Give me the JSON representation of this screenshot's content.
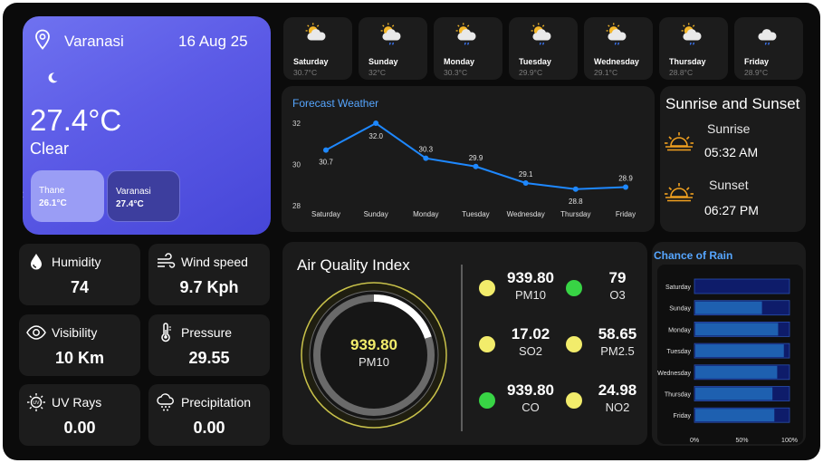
{
  "current": {
    "city": "Varanasi",
    "date": "16 Aug 25",
    "temperature": "27.4°C",
    "condition": "Clear",
    "locations": [
      {
        "name": "Thane",
        "temp": "26.1°C"
      },
      {
        "name": "Varanasi",
        "temp": "27.4°C"
      }
    ],
    "icons": {
      "location": "location-pin-icon",
      "moon": "moon-icon",
      "prev": "chevron-left-icon"
    }
  },
  "daily": [
    {
      "day": "Saturday",
      "temp": "30.7°C",
      "icon": "partly-cloudy-sun-icon"
    },
    {
      "day": "Sunday",
      "temp": "32°C",
      "icon": "sun-cloud-rain-icon"
    },
    {
      "day": "Monday",
      "temp": "30.3°C",
      "icon": "sun-cloud-rain-icon"
    },
    {
      "day": "Tuesday",
      "temp": "29.9°C",
      "icon": "sun-cloud-rain-icon"
    },
    {
      "day": "Wednesday",
      "temp": "29.1°C",
      "icon": "sun-cloud-rain-icon"
    },
    {
      "day": "Thursday",
      "temp": "28.8°C",
      "icon": "sun-cloud-rain-icon"
    },
    {
      "day": "Friday",
      "temp": "28.9°C",
      "icon": "cloud-rain-icon"
    }
  ],
  "forecast": {
    "title": "Forecast Weather",
    "chart_data": {
      "type": "line",
      "categories": [
        "Saturday",
        "Sunday",
        "Monday",
        "Tuesday",
        "Wednesday",
        "Thursday",
        "Friday"
      ],
      "values": [
        30.7,
        32.0,
        30.3,
        29.9,
        29.1,
        28.8,
        28.9
      ],
      "data_labels": [
        "30.7",
        "32.0",
        "30.3",
        "29.9",
        "29.1",
        "28.8",
        "28.9"
      ],
      "yticks": [
        "32",
        "30",
        "28"
      ],
      "ylim": [
        28,
        32
      ],
      "color": "#1e88ff"
    }
  },
  "sun": {
    "title": "Sunrise and Sunset",
    "sunrise_label": "Sunrise",
    "sunrise_time": "05:32 AM",
    "sunset_label": "Sunset",
    "sunset_time": "06:27 PM",
    "accent": "#f0a020"
  },
  "stats": [
    {
      "label": "Humidity",
      "value": "74",
      "icon": "droplet-icon"
    },
    {
      "label": "Wind speed",
      "value": "9.7 Kph",
      "icon": "wind-icon"
    },
    {
      "label": "Visibility",
      "value": "10 Km",
      "icon": "eye-icon"
    },
    {
      "label": "Pressure",
      "value": "29.55",
      "icon": "thermometer-icon"
    },
    {
      "label": "UV Rays",
      "value": "0.00",
      "icon": "uv-sun-icon"
    },
    {
      "label": "Precipitation",
      "value": "0.00",
      "icon": "cloud-drizzle-icon"
    }
  ],
  "aqi": {
    "title": "Air Quality Index",
    "gauge_value": "939.80",
    "gauge_label": "PM10",
    "gauge_fraction": 0.2,
    "pollutants": [
      {
        "value": "939.80",
        "name": "PM10",
        "color": "#f2ec6b"
      },
      {
        "value": "79",
        "name": "O3",
        "color": "#38d445"
      },
      {
        "value": "17.02",
        "name": "SO2",
        "color": "#f2ec6b"
      },
      {
        "value": "58.65",
        "name": "PM2.5",
        "color": "#f2ec6b"
      },
      {
        "value": "939.80",
        "name": "CO",
        "color": "#38d445"
      },
      {
        "value": "24.98",
        "name": "NO2",
        "color": "#f2ec6b"
      }
    ]
  },
  "rain": {
    "title": "Chance of Rain",
    "chart_data": {
      "type": "bar",
      "orientation": "horizontal",
      "categories": [
        "Saturday",
        "Sunday",
        "Monday",
        "Tuesday",
        "Wednesday",
        "Thursday",
        "Friday"
      ],
      "values": [
        0,
        72,
        89,
        95,
        88,
        83,
        85
      ],
      "xticks": [
        "0%",
        "50%",
        "100%"
      ],
      "xlim": [
        0,
        100
      ],
      "fill_color": "#1e60b0",
      "track_color": "#0e1c6a"
    }
  }
}
